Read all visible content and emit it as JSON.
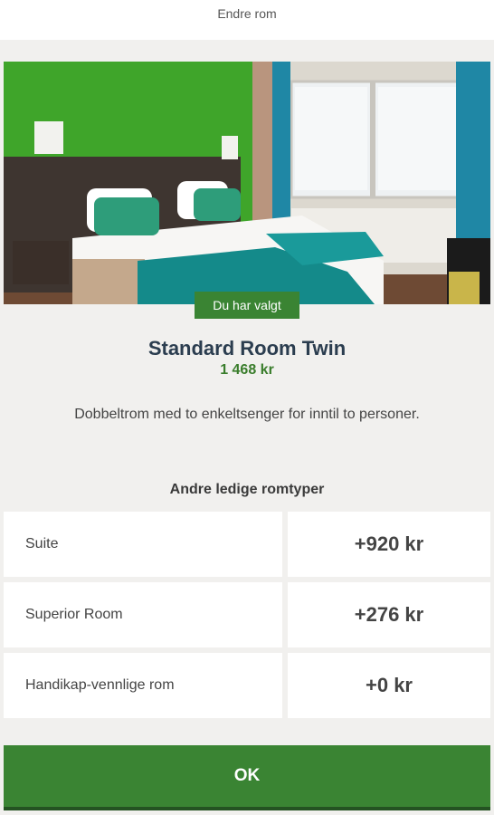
{
  "header": {
    "title": "Endre rom"
  },
  "selected_room": {
    "badge": "Du har valgt",
    "name": "Standard Room Twin",
    "price": "1 468 kr",
    "description": "Dobbeltrom med to enkeltsenger for inntil to personer."
  },
  "other_rooms": {
    "heading": "Andre ledige romtyper",
    "items": [
      {
        "name": "Suite",
        "delta": "+920 kr"
      },
      {
        "name": "Superior Room",
        "delta": "+276 kr"
      },
      {
        "name": "Handikap-vennlige rom",
        "delta": "+0 kr"
      }
    ]
  },
  "actions": {
    "ok_label": "OK"
  },
  "colors": {
    "accent_green": "#3a8433",
    "title_navy": "#2b3d4f",
    "price_green": "#3a7d2c"
  }
}
